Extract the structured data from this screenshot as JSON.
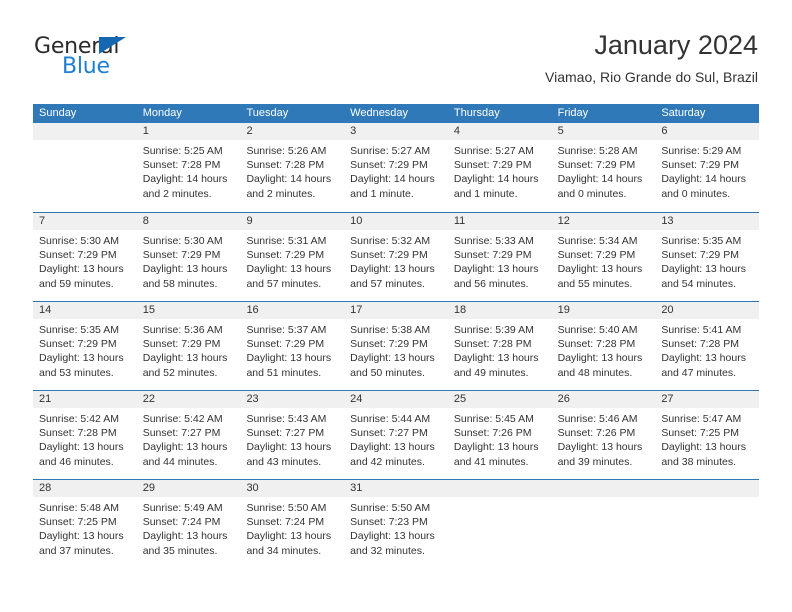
{
  "brand": {
    "line1": "General",
    "line2": "Blue",
    "triangle_color": "#1567b2",
    "line2_color": "#1f7fd0",
    "line1_color": "#2b2b2b"
  },
  "header": {
    "title": "January 2024",
    "subtitle": "Viamao, Rio Grande do Sul, Brazil"
  },
  "colors": {
    "header_row_bg": "#3079b8",
    "header_row_text": "#ffffff",
    "daynum_band_bg": "#f0f0f0",
    "week_divider": "#3079b8",
    "body_text": "#333333"
  },
  "calendar": {
    "weekday_headers": [
      "Sunday",
      "Monday",
      "Tuesday",
      "Wednesday",
      "Thursday",
      "Friday",
      "Saturday"
    ],
    "weeks": [
      [
        {
          "day": "",
          "lines": []
        },
        {
          "day": "1",
          "lines": [
            "Sunrise: 5:25 AM",
            "Sunset: 7:28 PM",
            "Daylight: 14 hours",
            "and 2 minutes."
          ]
        },
        {
          "day": "2",
          "lines": [
            "Sunrise: 5:26 AM",
            "Sunset: 7:28 PM",
            "Daylight: 14 hours",
            "and 2 minutes."
          ]
        },
        {
          "day": "3",
          "lines": [
            "Sunrise: 5:27 AM",
            "Sunset: 7:29 PM",
            "Daylight: 14 hours",
            "and 1 minute."
          ]
        },
        {
          "day": "4",
          "lines": [
            "Sunrise: 5:27 AM",
            "Sunset: 7:29 PM",
            "Daylight: 14 hours",
            "and 1 minute."
          ]
        },
        {
          "day": "5",
          "lines": [
            "Sunrise: 5:28 AM",
            "Sunset: 7:29 PM",
            "Daylight: 14 hours",
            "and 0 minutes."
          ]
        },
        {
          "day": "6",
          "lines": [
            "Sunrise: 5:29 AM",
            "Sunset: 7:29 PM",
            "Daylight: 14 hours",
            "and 0 minutes."
          ]
        }
      ],
      [
        {
          "day": "7",
          "lines": [
            "Sunrise: 5:30 AM",
            "Sunset: 7:29 PM",
            "Daylight: 13 hours",
            "and 59 minutes."
          ]
        },
        {
          "day": "8",
          "lines": [
            "Sunrise: 5:30 AM",
            "Sunset: 7:29 PM",
            "Daylight: 13 hours",
            "and 58 minutes."
          ]
        },
        {
          "day": "9",
          "lines": [
            "Sunrise: 5:31 AM",
            "Sunset: 7:29 PM",
            "Daylight: 13 hours",
            "and 57 minutes."
          ]
        },
        {
          "day": "10",
          "lines": [
            "Sunrise: 5:32 AM",
            "Sunset: 7:29 PM",
            "Daylight: 13 hours",
            "and 57 minutes."
          ]
        },
        {
          "day": "11",
          "lines": [
            "Sunrise: 5:33 AM",
            "Sunset: 7:29 PM",
            "Daylight: 13 hours",
            "and 56 minutes."
          ]
        },
        {
          "day": "12",
          "lines": [
            "Sunrise: 5:34 AM",
            "Sunset: 7:29 PM",
            "Daylight: 13 hours",
            "and 55 minutes."
          ]
        },
        {
          "day": "13",
          "lines": [
            "Sunrise: 5:35 AM",
            "Sunset: 7:29 PM",
            "Daylight: 13 hours",
            "and 54 minutes."
          ]
        }
      ],
      [
        {
          "day": "14",
          "lines": [
            "Sunrise: 5:35 AM",
            "Sunset: 7:29 PM",
            "Daylight: 13 hours",
            "and 53 minutes."
          ]
        },
        {
          "day": "15",
          "lines": [
            "Sunrise: 5:36 AM",
            "Sunset: 7:29 PM",
            "Daylight: 13 hours",
            "and 52 minutes."
          ]
        },
        {
          "day": "16",
          "lines": [
            "Sunrise: 5:37 AM",
            "Sunset: 7:29 PM",
            "Daylight: 13 hours",
            "and 51 minutes."
          ]
        },
        {
          "day": "17",
          "lines": [
            "Sunrise: 5:38 AM",
            "Sunset: 7:29 PM",
            "Daylight: 13 hours",
            "and 50 minutes."
          ]
        },
        {
          "day": "18",
          "lines": [
            "Sunrise: 5:39 AM",
            "Sunset: 7:28 PM",
            "Daylight: 13 hours",
            "and 49 minutes."
          ]
        },
        {
          "day": "19",
          "lines": [
            "Sunrise: 5:40 AM",
            "Sunset: 7:28 PM",
            "Daylight: 13 hours",
            "and 48 minutes."
          ]
        },
        {
          "day": "20",
          "lines": [
            "Sunrise: 5:41 AM",
            "Sunset: 7:28 PM",
            "Daylight: 13 hours",
            "and 47 minutes."
          ]
        }
      ],
      [
        {
          "day": "21",
          "lines": [
            "Sunrise: 5:42 AM",
            "Sunset: 7:28 PM",
            "Daylight: 13 hours",
            "and 46 minutes."
          ]
        },
        {
          "day": "22",
          "lines": [
            "Sunrise: 5:42 AM",
            "Sunset: 7:27 PM",
            "Daylight: 13 hours",
            "and 44 minutes."
          ]
        },
        {
          "day": "23",
          "lines": [
            "Sunrise: 5:43 AM",
            "Sunset: 7:27 PM",
            "Daylight: 13 hours",
            "and 43 minutes."
          ]
        },
        {
          "day": "24",
          "lines": [
            "Sunrise: 5:44 AM",
            "Sunset: 7:27 PM",
            "Daylight: 13 hours",
            "and 42 minutes."
          ]
        },
        {
          "day": "25",
          "lines": [
            "Sunrise: 5:45 AM",
            "Sunset: 7:26 PM",
            "Daylight: 13 hours",
            "and 41 minutes."
          ]
        },
        {
          "day": "26",
          "lines": [
            "Sunrise: 5:46 AM",
            "Sunset: 7:26 PM",
            "Daylight: 13 hours",
            "and 39 minutes."
          ]
        },
        {
          "day": "27",
          "lines": [
            "Sunrise: 5:47 AM",
            "Sunset: 7:25 PM",
            "Daylight: 13 hours",
            "and 38 minutes."
          ]
        }
      ],
      [
        {
          "day": "28",
          "lines": [
            "Sunrise: 5:48 AM",
            "Sunset: 7:25 PM",
            "Daylight: 13 hours",
            "and 37 minutes."
          ]
        },
        {
          "day": "29",
          "lines": [
            "Sunrise: 5:49 AM",
            "Sunset: 7:24 PM",
            "Daylight: 13 hours",
            "and 35 minutes."
          ]
        },
        {
          "day": "30",
          "lines": [
            "Sunrise: 5:50 AM",
            "Sunset: 7:24 PM",
            "Daylight: 13 hours",
            "and 34 minutes."
          ]
        },
        {
          "day": "31",
          "lines": [
            "Sunrise: 5:50 AM",
            "Sunset: 7:23 PM",
            "Daylight: 13 hours",
            "and 32 minutes."
          ]
        },
        {
          "day": "",
          "lines": []
        },
        {
          "day": "",
          "lines": []
        },
        {
          "day": "",
          "lines": []
        }
      ]
    ]
  }
}
